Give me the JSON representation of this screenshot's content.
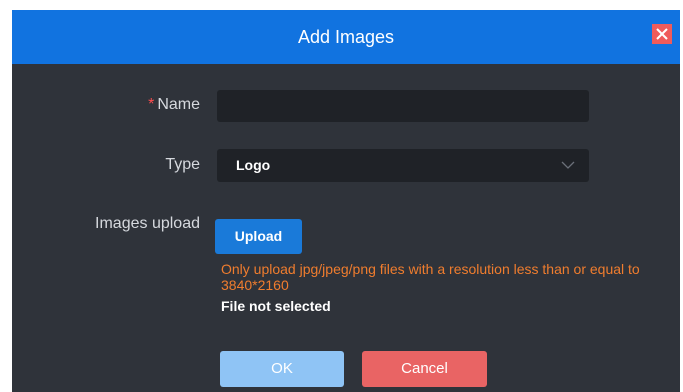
{
  "dialog": {
    "title": "Add Images",
    "close_icon": "close-icon",
    "colors": {
      "header": "#1173e0",
      "body": "#2f333a",
      "field_bg": "#1f2227",
      "required": "#ff4d4f",
      "hint": "#f07d2e",
      "close": "#ef5b5b"
    }
  },
  "form": {
    "name": {
      "label": "Name",
      "required_mark": "*",
      "value": ""
    },
    "type": {
      "label": "Type",
      "selected": "Logo",
      "icon": "chevron-down-icon"
    },
    "upload": {
      "label": "Images upload",
      "button_label": "Upload",
      "hint": "Only upload jpg/jpeg/png files with a resolution less than or equal to 3840*2160",
      "file_status": "File not selected"
    }
  },
  "footer": {
    "ok_label": "OK",
    "cancel_label": "Cancel",
    "ok_color": "#8fc4f5",
    "cancel_color": "#e96464"
  }
}
